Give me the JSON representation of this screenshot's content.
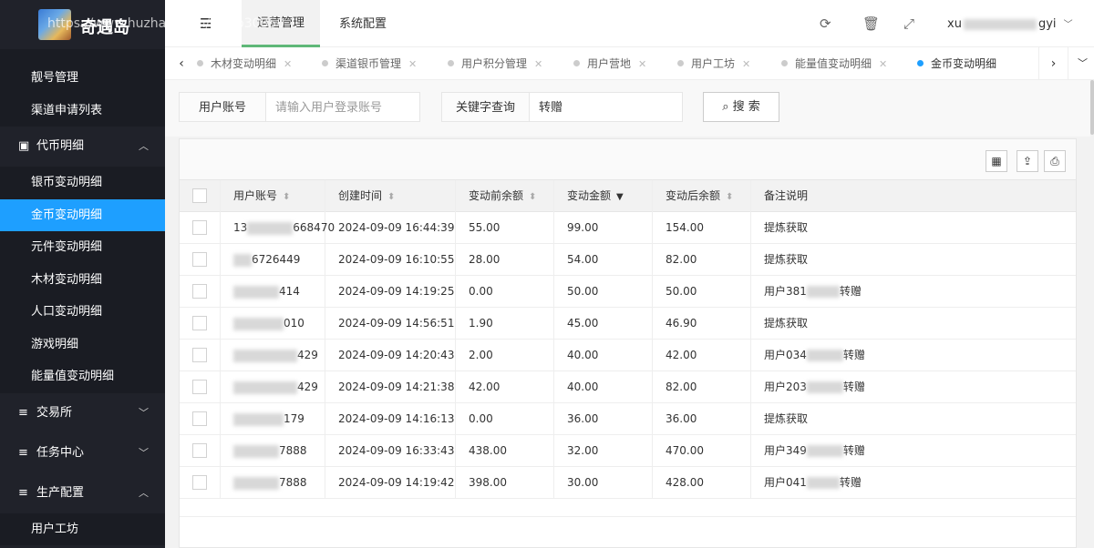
{
  "app": {
    "name": "奇遇岛",
    "watermark": "https://www.huzhan.com/ishop30850"
  },
  "header": {
    "nav": [
      "运营管理",
      "系统配置"
    ],
    "user": "xu",
    "user_suffix": "gyi"
  },
  "sidebar": {
    "top_items": [
      "靓号管理",
      "渠道申请列表"
    ],
    "group_coin": "代币明细",
    "coin_items": [
      "银币变动明细",
      "金币变动明细",
      "元件变动明细",
      "木材变动明细",
      "人口变动明细",
      "游戏明细",
      "能量值变动明细"
    ],
    "groups_after": [
      "交易所",
      "任务中心",
      "生产配置"
    ],
    "last_item": "用户工坊"
  },
  "tabs": [
    {
      "label": "木材变动明细"
    },
    {
      "label": "渠道银币管理"
    },
    {
      "label": "用户积分管理"
    },
    {
      "label": "用户营地"
    },
    {
      "label": "用户工坊"
    },
    {
      "label": "能量值变动明细"
    },
    {
      "label": "金币变动明细"
    }
  ],
  "search": {
    "account_label": "用户账号",
    "account_placeholder": "请输入用户登录账号",
    "keyword_label": "关键字查询",
    "keyword_value": "转赠",
    "button": "搜 索"
  },
  "table": {
    "columns": [
      "用户账号",
      "创建时间",
      "变动前余额",
      "变动金额",
      "变动后余额",
      "备注说明"
    ],
    "rows": [
      {
        "account_a": "13",
        "account_b": "668470",
        "time": "2024-09-09 16:44:39",
        "before": "55.00",
        "change": "99.00",
        "after": "154.00",
        "note_a": "提炼获取",
        "note_b": ""
      },
      {
        "account_a": "",
        "account_b": "6726449",
        "time": "2024-09-09 16:10:55",
        "before": "28.00",
        "change": "54.00",
        "after": "82.00",
        "note_a": "提炼获取",
        "note_b": ""
      },
      {
        "account_a": "",
        "account_b": "414",
        "time": "2024-09-09 14:19:25",
        "before": "0.00",
        "change": "50.00",
        "after": "50.00",
        "note_a": "用户381",
        "note_b": "转赠"
      },
      {
        "account_a": "",
        "account_b": "010",
        "time": "2024-09-09 14:56:51",
        "before": "1.90",
        "change": "45.00",
        "after": "46.90",
        "note_a": "提炼获取",
        "note_b": ""
      },
      {
        "account_a": "",
        "account_b": "429",
        "time": "2024-09-09 14:20:43",
        "before": "2.00",
        "change": "40.00",
        "after": "42.00",
        "note_a": "用户034",
        "note_b": "转赠"
      },
      {
        "account_a": "",
        "account_b": "429",
        "time": "2024-09-09 14:21:38",
        "before": "42.00",
        "change": "40.00",
        "after": "82.00",
        "note_a": "用户203",
        "note_b": "转赠"
      },
      {
        "account_a": "",
        "account_b": "179",
        "time": "2024-09-09 14:16:13",
        "before": "0.00",
        "change": "36.00",
        "after": "36.00",
        "note_a": "提炼获取",
        "note_b": ""
      },
      {
        "account_a": "",
        "account_b": "7888",
        "time": "2024-09-09 16:33:43",
        "before": "438.00",
        "change": "32.00",
        "after": "470.00",
        "note_a": "用户349",
        "note_b": "转赠"
      },
      {
        "account_a": "",
        "account_b": "7888",
        "time": "2024-09-09 14:19:42",
        "before": "398.00",
        "change": "30.00",
        "after": "428.00",
        "note_a": "用户041",
        "note_b": "转赠"
      }
    ]
  }
}
